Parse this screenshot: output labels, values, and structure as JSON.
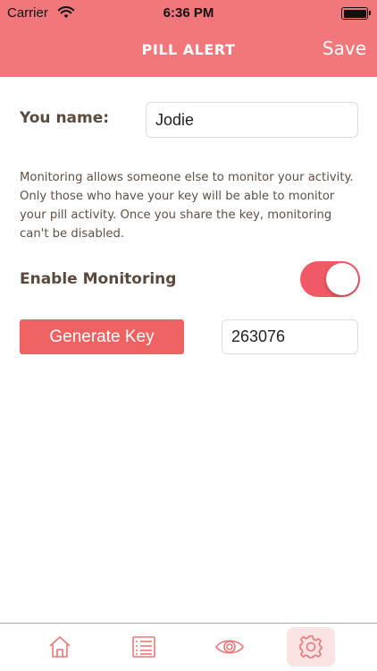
{
  "status": {
    "carrier": "Carrier",
    "time": "6:36 PM"
  },
  "header": {
    "title": "PILL ALERT",
    "save_label": "Save"
  },
  "form": {
    "name_label": "You name:",
    "name_value": "Jodie",
    "info_text": "Monitoring allows someone else to monitor your activity. Only those who have your key will be able to monitor your pill activity. Once you share the key, monitoring can't be disabled.",
    "monitoring_label": "Enable Monitoring",
    "monitoring_enabled": true,
    "generate_label": "Generate Key",
    "key_value": "263076"
  },
  "tabs": [
    {
      "icon": "home-icon",
      "active": false
    },
    {
      "icon": "list-icon",
      "active": false
    },
    {
      "icon": "eye-icon",
      "active": false
    },
    {
      "icon": "gear-icon",
      "active": true
    }
  ],
  "colors": {
    "accent": "#f2777a",
    "toggle_on": "#f05a66",
    "button": "#ef6262",
    "tab_icon": "#e9787a"
  }
}
